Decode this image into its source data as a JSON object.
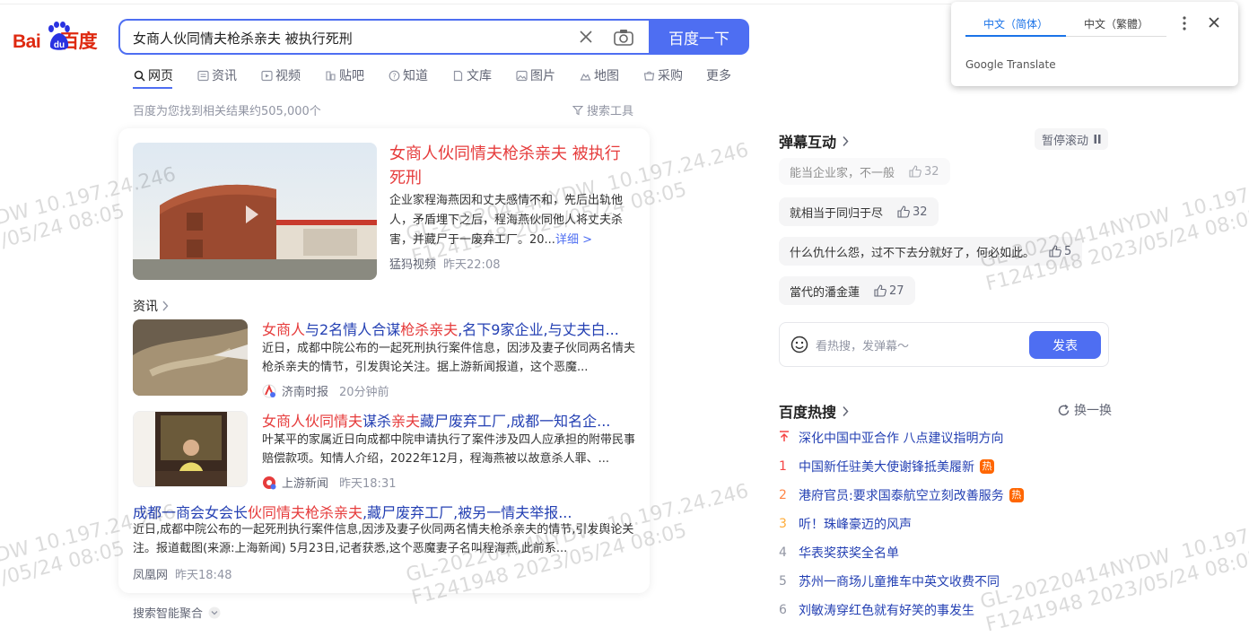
{
  "search": {
    "query": "女商人伙同情夫枪杀亲夫 被执行死刑",
    "button_label": "百度一下"
  },
  "logo": {
    "part1": "Bai",
    "part2": "du",
    "part3": "百度"
  },
  "tabs": [
    {
      "label": "网页",
      "icon": "search-icon"
    },
    {
      "label": "资讯",
      "icon": "news-icon"
    },
    {
      "label": "视频",
      "icon": "video-icon"
    },
    {
      "label": "贴吧",
      "icon": "tieba-icon"
    },
    {
      "label": "知道",
      "icon": "question-icon"
    },
    {
      "label": "文库",
      "icon": "document-icon"
    },
    {
      "label": "图片",
      "icon": "image-icon"
    },
    {
      "label": "地图",
      "icon": "map-icon"
    },
    {
      "label": "采购",
      "icon": "cart-icon"
    },
    {
      "label": "更多",
      "icon": ""
    }
  ],
  "result_count": "百度为您找到相关结果约505,000个",
  "search_tools": "搜索工具",
  "top_result": {
    "title": "女商人伙同情夫枪杀亲夫 被执行死刑",
    "desc": "企业家程海燕因和丈夫感情不和，先后出轨他人，矛盾埋下之后，程海燕伙同他人将丈夫杀害，并藏尸于一废弃工厂。20...",
    "more": "详细 >",
    "source": "猛犸视频",
    "time": "昨天22:08"
  },
  "news_section_label": "资讯",
  "news": [
    {
      "title_hl1": "女商人",
      "title_mid": "与2名情人合谋",
      "title_hl2": "枪杀亲夫",
      "title_end": ",名下9家企业,与丈夫白...",
      "desc": "近日，成都中院公布的一起死刑执行案件信息，因涉及妻子伙同两名情夫枪杀亲夫的情节，引发舆论关注。据上游新闻报道，这个恶魔...",
      "source": "济南时报",
      "time": "20分钟前"
    },
    {
      "title_hl1": "女商人伙同情夫",
      "title_mid": "谋杀",
      "title_hl2": "亲夫",
      "title_end": "藏尸废弃工厂,成都一知名企...",
      "desc": "叶某平的家属近日向成都中院申请执行了案件涉及四人应承担的附带民事赔偿款项。知情人介绍，2022年12月，程海燕被以故意杀人罪、...",
      "source": "上游新闻",
      "time": "昨天18:31"
    }
  ],
  "sub_result": {
    "title_pre": "成都一商会女会长",
    "title_hl": "伙同情夫枪杀亲夫",
    "title_end": ",藏尸废弃工厂,被另一情夫举报...",
    "desc": "近日,成都中院公布的一起死刑执行案件信息,因涉及妻子伙同两名情夫枪杀亲夫的情节,引发舆论关注。报道截图(来源:上海新闻) 5月23日,记者获悉,这个恶魔妻子名叫程海燕,此前系...",
    "source": "凤凰网",
    "time": "昨天18:48"
  },
  "aggregation_label": "搜索智能聚合",
  "danmu": {
    "title": "弹幕互动",
    "pause_label": "暂停滚动",
    "items": [
      {
        "text": "能当企业家，不一般",
        "likes": "32"
      },
      {
        "text": "就相当于同归于尽",
        "likes": "32"
      },
      {
        "text": "什么仇什么怨，过不下去分就好了，何必如此。",
        "likes": "5"
      },
      {
        "text": "當代的潘金蓮",
        "likes": "27"
      }
    ],
    "input_placeholder": "看热搜，发弹幕～",
    "send_label": "发表"
  },
  "hot": {
    "title": "百度热搜",
    "refresh_label": "换一换",
    "items": [
      {
        "rank": "",
        "text": "深化中国中亚合作 八点建议指明方向",
        "badge": "",
        "rank_color": "#f54545"
      },
      {
        "rank": "1",
        "text": "中国新任驻美大使谢锋抵美履新",
        "badge": "热",
        "rank_color": "#f54545"
      },
      {
        "rank": "2",
        "text": "港府官员:要求国泰航空立刻改善服务",
        "badge": "热",
        "rank_color": "#ff8547"
      },
      {
        "rank": "3",
        "text": "听！珠峰豪迈的风声",
        "badge": "",
        "rank_color": "#ffac38"
      },
      {
        "rank": "4",
        "text": "华表奖获奖全名单",
        "badge": "",
        "rank_color": "#9195a3"
      },
      {
        "rank": "5",
        "text": "苏州一商场儿童推车中英文收费不同",
        "badge": "",
        "rank_color": "#9195a3"
      },
      {
        "rank": "6",
        "text": "刘敏涛穿红色就有好笑的事发生",
        "badge": "",
        "rank_color": "#9195a3"
      }
    ]
  },
  "translate": {
    "lang_simplified": "中文（简体）",
    "lang_traditional": "中文（繁體）",
    "brand": "Google Translate"
  },
  "watermark": {
    "ip": "10.197.24.246",
    "time": "2023/05/24 08:05",
    "id": "GL-20220414NYDW",
    "user": "F1241948 2023/05/24 08:05",
    "frag_a": "DW  10.197.24.246",
    "frag_b": "/05/24 08:05"
  }
}
